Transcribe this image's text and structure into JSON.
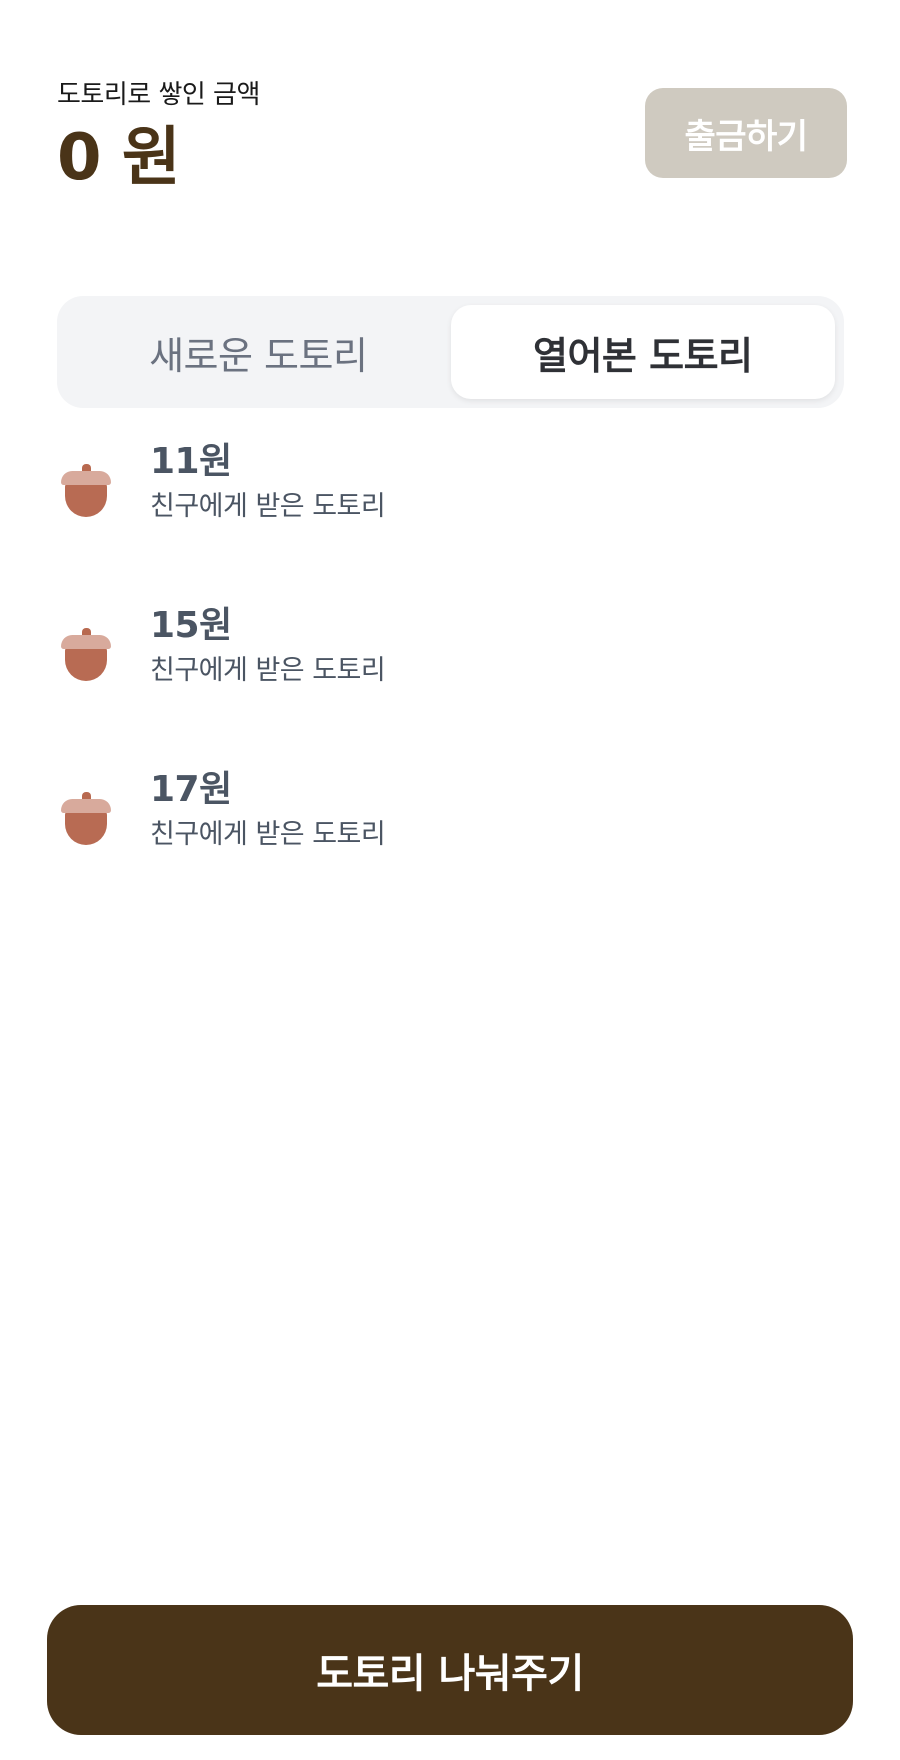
{
  "header": {
    "balance_label": "도토리로 쌓인 금액",
    "balance_amount": "0 원",
    "withdraw_label": "출금하기"
  },
  "tabs": [
    {
      "label": "새로운 도토리",
      "active": false
    },
    {
      "label": "열어본 도토리",
      "active": true
    }
  ],
  "items": [
    {
      "amount": "11원",
      "description": "친구에게 받은 도토리",
      "icon": "acorn-icon"
    },
    {
      "amount": "15원",
      "description": "친구에게 받은 도토리",
      "icon": "acorn-icon"
    },
    {
      "amount": "17원",
      "description": "친구에게 받은 도토리",
      "icon": "acorn-icon"
    }
  ],
  "footer": {
    "share_label": "도토리 나눠주기"
  },
  "colors": {
    "brand": "#4a3418",
    "withdraw_disabled": "#cfcac0",
    "tab_bg": "#f3f4f6",
    "acorn_cap": "#d8aa9c",
    "acorn_nut": "#b86b53"
  }
}
